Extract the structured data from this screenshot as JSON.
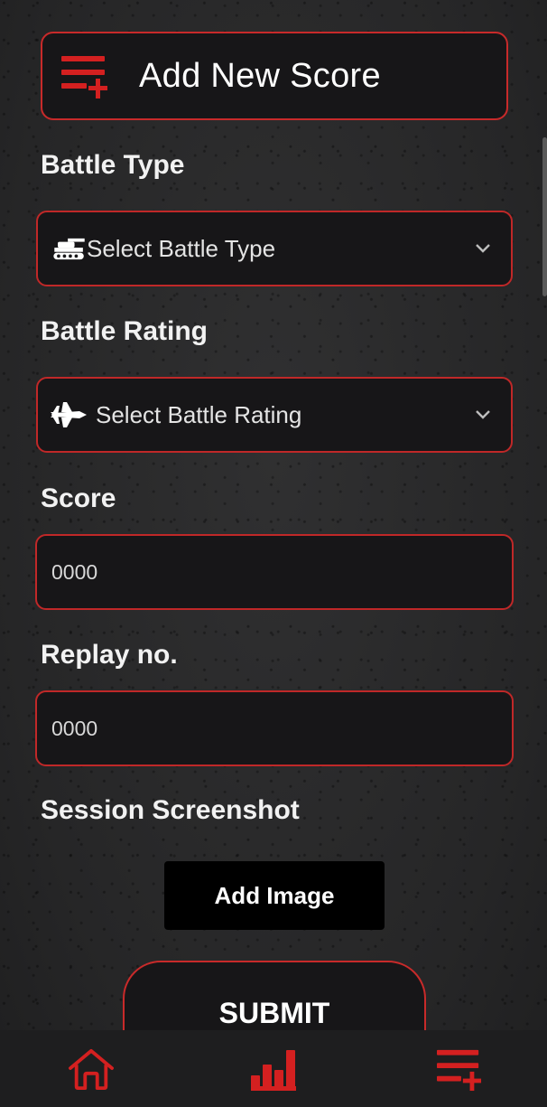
{
  "header": {
    "title": "Add New Score",
    "icon": "playlist-add-icon"
  },
  "form": {
    "battle_type": {
      "label": "Battle Type",
      "placeholder": "Select Battle Type",
      "icon": "tank-icon"
    },
    "battle_rating": {
      "label": "Battle Rating",
      "placeholder": "Select Battle Rating",
      "icon": "jet-plane-icon"
    },
    "score": {
      "label": "Score",
      "placeholder": "0000"
    },
    "replay": {
      "label": "Replay no.",
      "placeholder": "0000"
    },
    "screenshot": {
      "label": "Session Screenshot",
      "button_label": "Add Image"
    },
    "submit_label": "SUBMIT"
  },
  "nav": {
    "items": [
      {
        "icon": "home-icon",
        "active": false
      },
      {
        "icon": "bar-chart-icon",
        "active": false
      },
      {
        "icon": "playlist-add-icon",
        "active": true
      }
    ]
  },
  "colors": {
    "accent": "#d42020",
    "border": "#c82a2a",
    "card": "#171618",
    "button": "#000000",
    "nav": "#1e1e1f"
  }
}
